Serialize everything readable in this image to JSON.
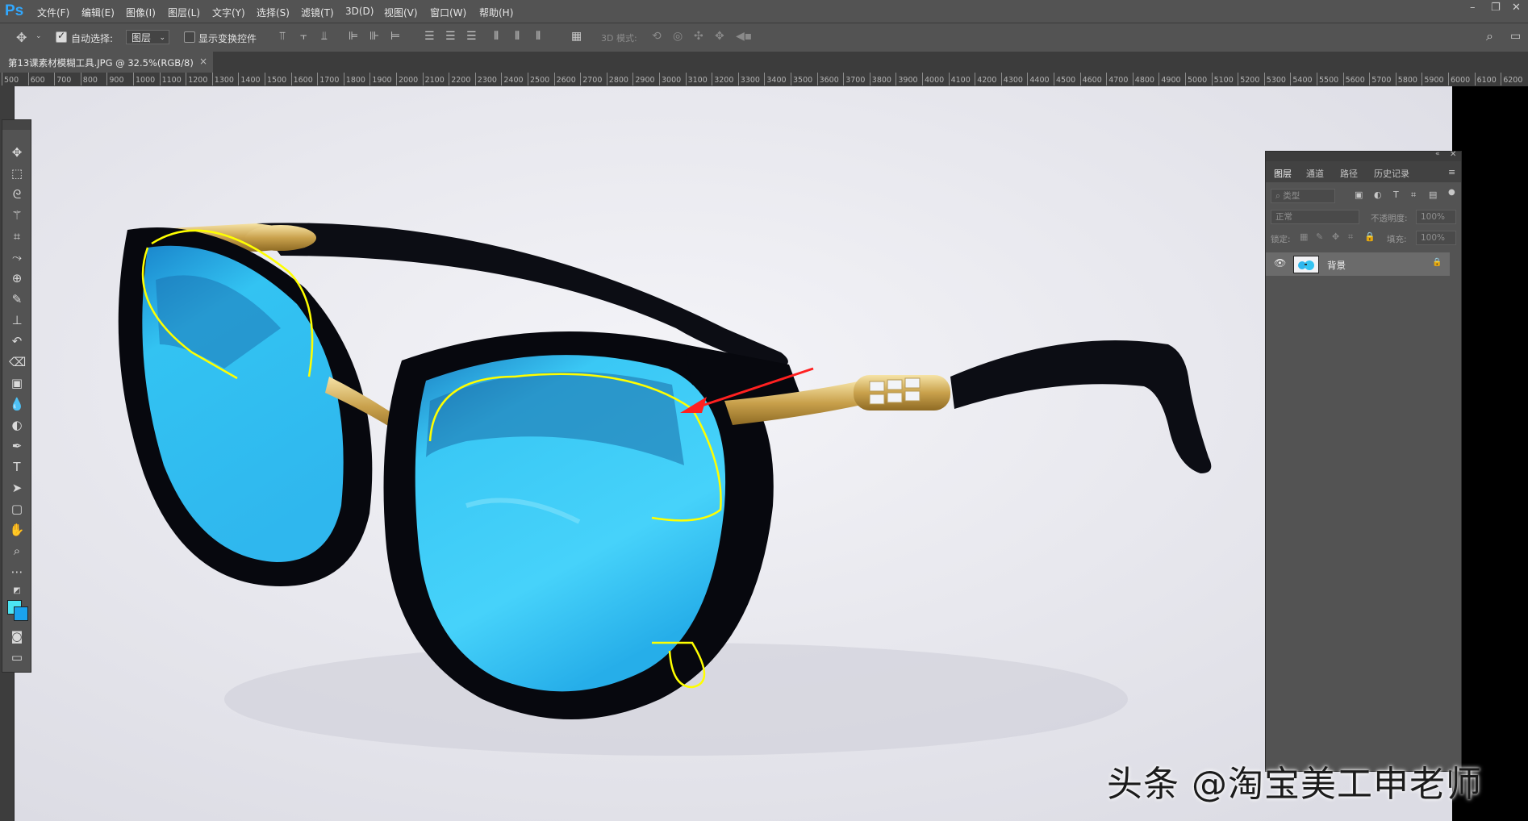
{
  "app": {
    "logo": "Ps"
  },
  "menu": [
    "文件(F)",
    "编辑(E)",
    "图像(I)",
    "图层(L)",
    "文字(Y)",
    "选择(S)",
    "滤镜(T)",
    "3D(D)",
    "视图(V)",
    "窗口(W)",
    "帮助(H)"
  ],
  "window_controls": {
    "minimize": "–",
    "restore": "❐",
    "close": "✕"
  },
  "options": {
    "auto_select_label": "自动选择:",
    "auto_select_checked": true,
    "auto_select_target": "图层",
    "show_transform_label": "显示变换控件",
    "show_transform_checked": false,
    "mode_3d_label": "3D 模式:"
  },
  "document": {
    "tab_title": "第13课素材模糊工具.JPG @ 32.5%(RGB/8)",
    "tab_close": "×"
  },
  "ruler": {
    "ticks": [
      "500",
      "600",
      "700",
      "800",
      "900",
      "1000",
      "1100",
      "1200",
      "1300",
      "1400",
      "1500",
      "1600",
      "1700",
      "1800",
      "1900",
      "2000",
      "2100",
      "2200",
      "2300",
      "2400",
      "2500",
      "2600",
      "2700",
      "2800",
      "2900",
      "3000",
      "3100",
      "3200",
      "3300",
      "3400",
      "3500",
      "3600",
      "3700",
      "3800",
      "3900",
      "4000",
      "4100",
      "4200",
      "4300",
      "4400",
      "4500",
      "4600",
      "4700",
      "4800",
      "4900",
      "5000",
      "5100",
      "5200",
      "5300",
      "5400",
      "5500",
      "5600",
      "5700",
      "5800",
      "5900",
      "6000",
      "6100",
      "6200"
    ]
  },
  "colors": {
    "foreground": "#4ce4f2",
    "background": "#1aa3ee",
    "annotation": "#ffff00",
    "arrow": "#ff2020"
  },
  "layers_panel": {
    "tabs": [
      "图层",
      "通道",
      "路径",
      "历史记录"
    ],
    "active_tab": "图层",
    "filter_label": "类型",
    "blend_mode": "正常",
    "opacity_label": "不透明度:",
    "opacity_value": "100%",
    "lock_label": "锁定:",
    "fill_label": "填充:",
    "fill_value": "100%",
    "layers": [
      {
        "name": "背景",
        "visible": true,
        "locked": true
      }
    ]
  },
  "watermark": "头条 @淘宝美工申老师"
}
